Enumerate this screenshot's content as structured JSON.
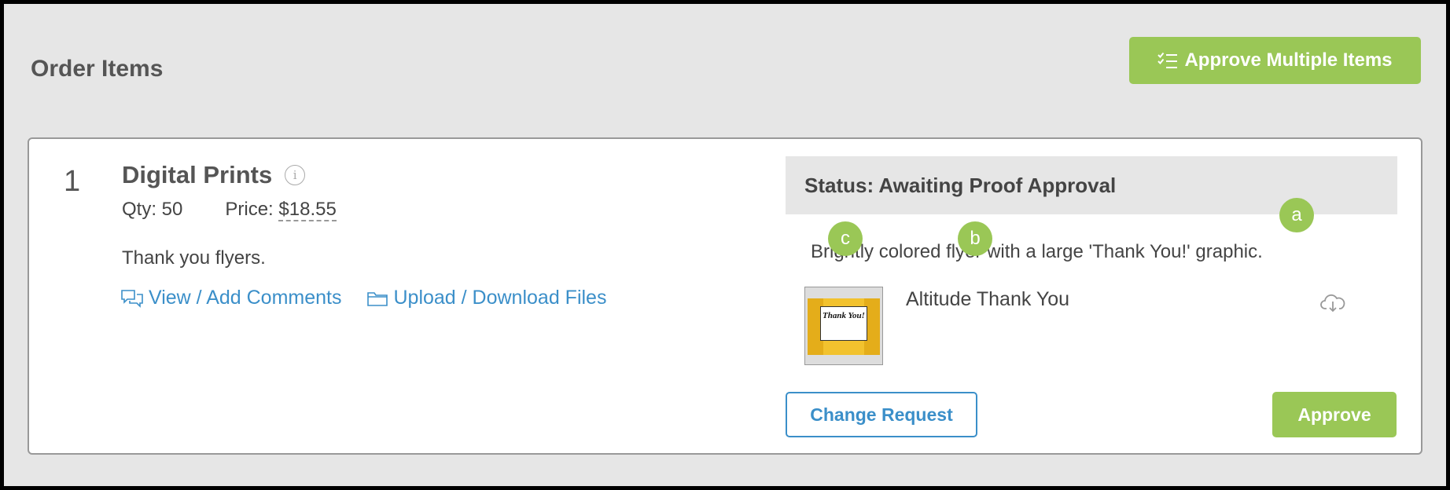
{
  "page": {
    "title": "Order Items"
  },
  "toolbar": {
    "approve_multiple_label": "Approve Multiple Items",
    "approve_multiple_icon": "checklist-icon"
  },
  "item": {
    "number": "1",
    "title": "Digital Prints",
    "qty_label": "Qty: 50",
    "price_label": "Price:",
    "price_value": "$18.55",
    "description": "Thank you flyers.",
    "links": {
      "comments": "View / Add Comments",
      "files": "Upload / Download Files"
    }
  },
  "proof": {
    "status": "Status: Awaiting Proof Approval",
    "description": "Brightly colored flyer with a large 'Thank You!' graphic.",
    "file_name": "Altitude Thank You",
    "thumbnail_text": "Thank You!",
    "change_request_label": "Change Request",
    "approve_label": "Approve"
  },
  "markers": {
    "a": "a",
    "b": "b",
    "c": "c"
  },
  "colors": {
    "accent_green": "#9ac756",
    "link_blue": "#3b8fc9",
    "panel_gray": "#e6e6e6"
  }
}
